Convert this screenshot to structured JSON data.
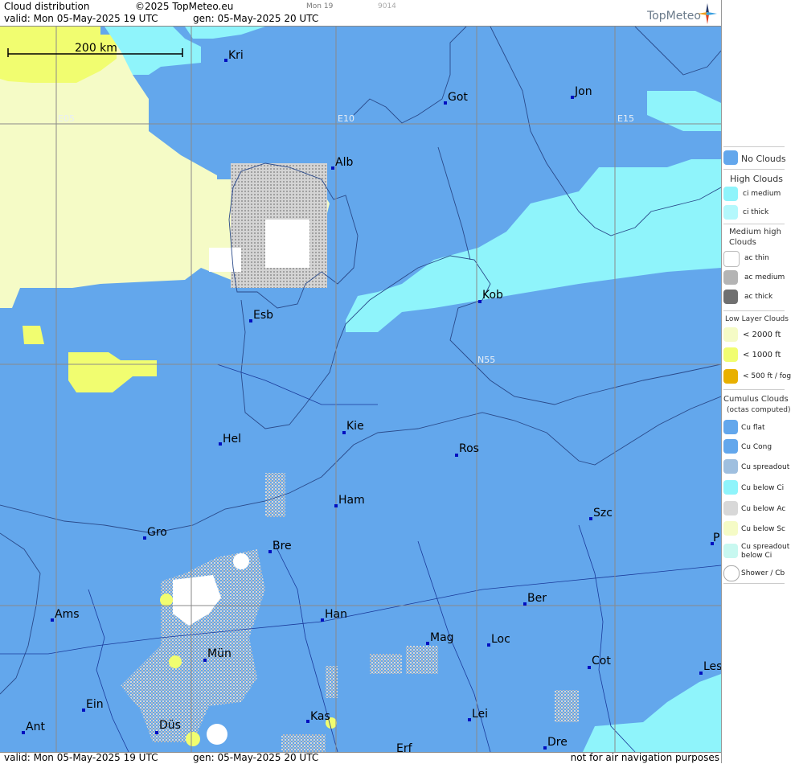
{
  "header": {
    "product": "Cloud distribution",
    "copyright": "©2025 TopMeteo.eu",
    "valid": "valid:  Mon  05-May-2025  19 UTC",
    "gen": "gen: 05-May-2025 20 UTC",
    "mini_day": "Mon 19",
    "mini_code": "9014",
    "logo": "TopMeteo"
  },
  "footer": {
    "valid": "valid:  Mon  05-May-2025  19 UTC",
    "gen": "gen: 05-May-2025 20 UTC",
    "disclaimer": "not for air navigation purposes"
  },
  "map": {
    "scale_label": "200 km",
    "grid_labels": [
      "E05",
      "E10",
      "E15",
      "N55"
    ],
    "cities": [
      "Kri",
      "Got",
      "Jon",
      "Alb",
      "Esb",
      "Kob",
      "Kie",
      "Hel",
      "Ros",
      "Ham",
      "Szc",
      "Gro",
      "Bre",
      "P",
      "Ber",
      "Ams",
      "Han",
      "Mag",
      "Loc",
      "Mün",
      "Cot",
      "Les",
      "Ein",
      "Kas",
      "Lei",
      "Ant",
      "Düs",
      "Dre",
      "Erf"
    ],
    "colors": {
      "no_clouds": "#63a7ec",
      "ci": "#8ff4fb",
      "low_2000": "#f5fbc6",
      "low_1000": "#f1fd70",
      "fog": "#e8b000",
      "ac": "#c8c8c8"
    }
  },
  "legend": {
    "no_clouds": "No Clouds",
    "high_title": "High Clouds",
    "ci_medium": "ci medium",
    "ci_thick": "ci thick",
    "medium_title_1": "Medium high",
    "medium_title_2": "Clouds",
    "ac_thin": "ac thin",
    "ac_medium": "ac medium",
    "ac_thick": "ac thick",
    "low_title": "Low Layer Clouds",
    "low_2000": "< 2000 ft",
    "low_1000": "< 1000 ft",
    "low_500": "< 500 ft / fog",
    "cu_title": "Cumulus Clouds",
    "cu_sub": "(octas computed)",
    "cu_flat": "Cu flat",
    "cu_cong": "Cu Cong",
    "cu_spread": "Cu spreadout",
    "cu_below_ci": "Cu below Ci",
    "cu_below_ac": "Cu below Ac",
    "cu_below_sc": "Cu below Sc",
    "cu_spread_ci_1": "Cu spreadout",
    "cu_spread_ci_2": "below Ci",
    "shower": "Shower / Cb"
  }
}
